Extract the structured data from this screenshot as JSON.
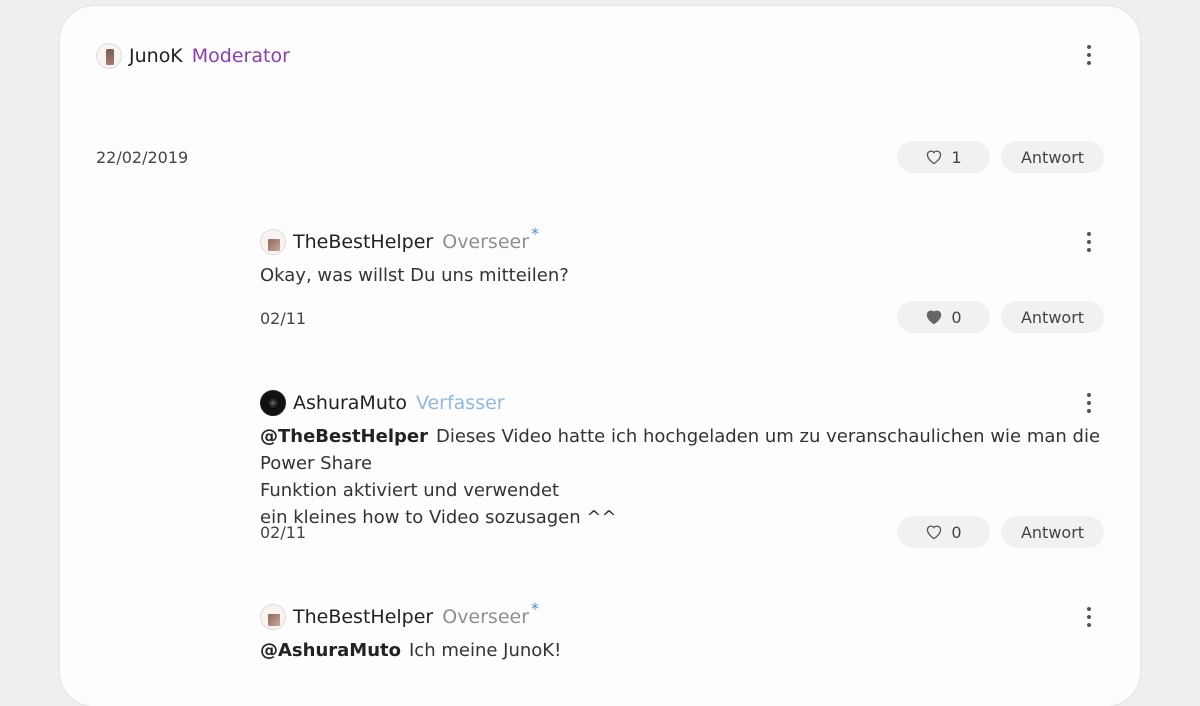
{
  "post": {
    "author": "JunoK",
    "role": "Moderator",
    "date": "22/02/2019",
    "likes": "1",
    "reply_label": "Antwort",
    "icons": {
      "avatar": "avatar-figure",
      "menu": "more-vertical-icon",
      "like": "heart-outline-icon"
    }
  },
  "comments": [
    {
      "author": "TheBestHelper",
      "role": "Overseer",
      "role_marker": "*",
      "mention": "",
      "text": "Okay, was willst Du uns mitteilen?",
      "date": "02/11",
      "likes": "0",
      "liked": true,
      "reply_label": "Antwort"
    },
    {
      "author": "AshuraMuto",
      "role": "Verfasser",
      "mention": "@TheBestHelper",
      "text_line1": "Dieses Video hatte ich hochgeladen um zu veranschaulichen wie man die Power Share",
      "text_line2": "Funktion aktiviert und verwendet",
      "text_line3": "ein kleines how to Video sozusagen ^^",
      "date": "02/11",
      "likes": "0",
      "liked": false,
      "reply_label": "Antwort"
    },
    {
      "author": "TheBestHelper",
      "role": "Overseer",
      "role_marker": "*",
      "mention": "@AshuraMuto",
      "text": "Ich meine JunoK!"
    }
  ],
  "colors": {
    "moderator": "#8a3eb0",
    "overseer": "#8f8f8f",
    "author_role": "#8fb9e2",
    "star": "#4f8fd6",
    "pill": "#f1f1f1"
  }
}
